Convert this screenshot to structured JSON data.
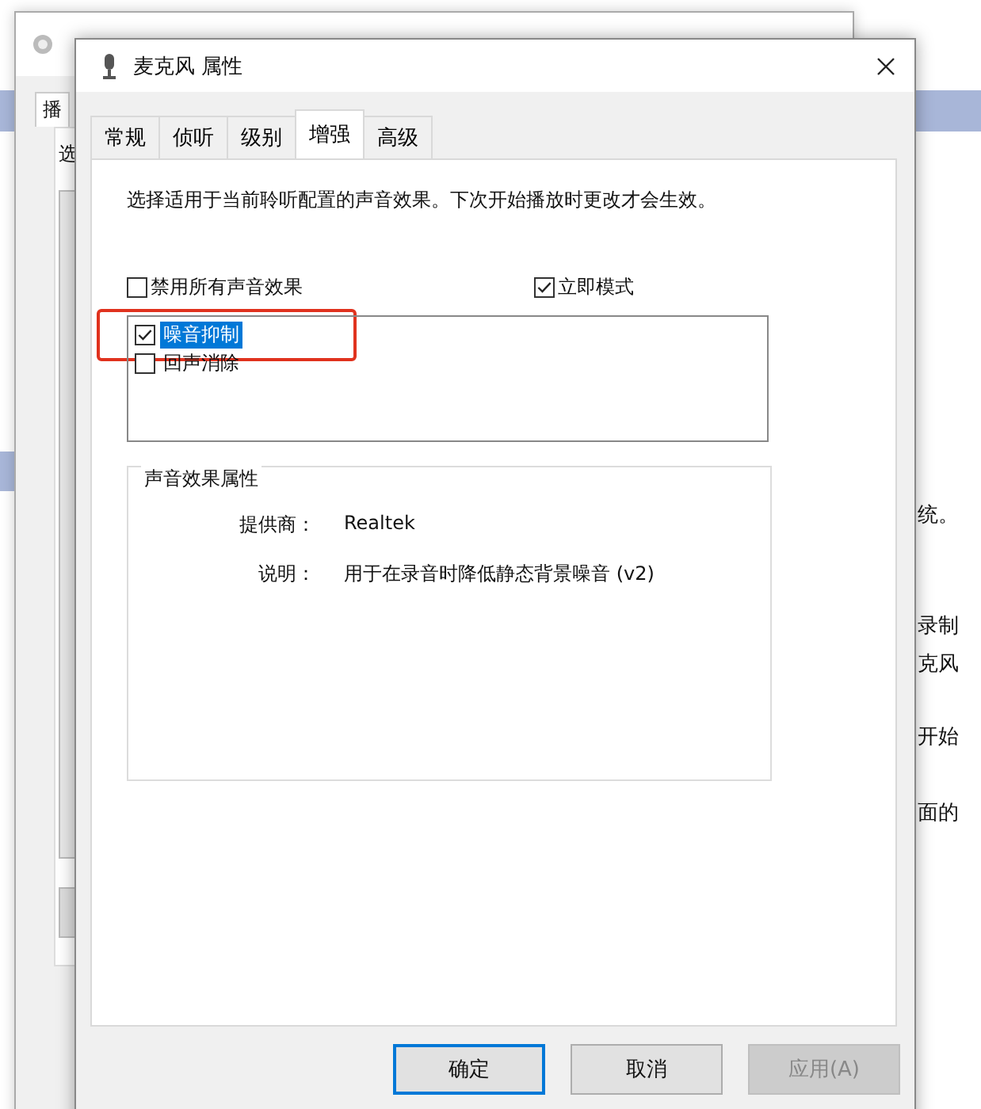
{
  "background_window": {
    "tab": "播",
    "text": "选"
  },
  "background_page": {
    "lines": [
      "统。",
      "录制",
      "克风",
      "开始",
      "面的"
    ]
  },
  "dialog": {
    "title": "麦克风 属性",
    "tabs": [
      {
        "label": "常规",
        "selected": false
      },
      {
        "label": "侦听",
        "selected": false
      },
      {
        "label": "级别",
        "selected": false
      },
      {
        "label": "增强",
        "selected": true
      },
      {
        "label": "高级",
        "selected": false
      }
    ],
    "intro": "选择适用于当前聆听配置的声音效果。下次开始播放时更改才会生效。",
    "disable_all": {
      "label": "禁用所有声音效果",
      "checked": false
    },
    "immediate_mode": {
      "label": "立即模式",
      "checked": true
    },
    "effects": [
      {
        "label": "噪音抑制",
        "checked": true,
        "selected": true
      },
      {
        "label": "回声消除",
        "checked": false,
        "selected": false
      }
    ],
    "properties": {
      "title": "声音效果属性",
      "rows": [
        {
          "label": "提供商：",
          "value": "Realtek"
        },
        {
          "label": "说明：",
          "value": "用于在录音时降低静态背景噪音 (v2)"
        }
      ]
    },
    "buttons": [
      {
        "label": "确定",
        "default": true,
        "disabled": false
      },
      {
        "label": "取消",
        "default": false,
        "disabled": false
      },
      {
        "label": "应用(A)",
        "default": false,
        "disabled": true
      }
    ]
  }
}
